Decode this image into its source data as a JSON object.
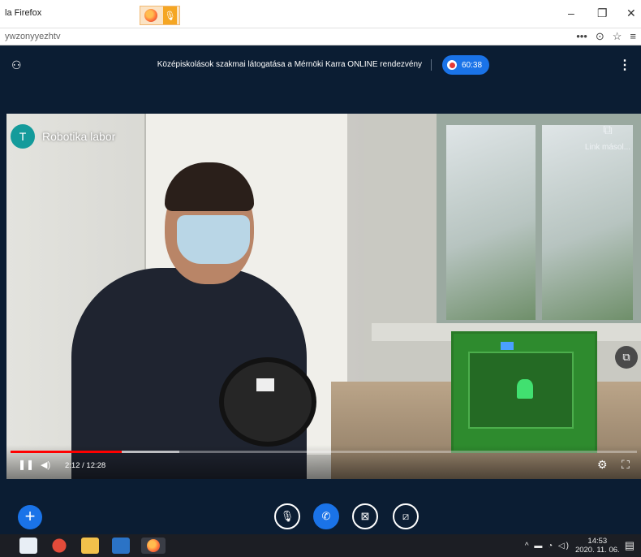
{
  "window": {
    "title": "la Firefox",
    "url": "ywzonyyezhtv",
    "minimize_glyph": "–",
    "maximize_glyph": "❐",
    "close_glyph": "✕",
    "menu_glyph": "•••",
    "pocket_glyph": "⊙",
    "star_glyph": "☆",
    "hamburger_glyph": "≡"
  },
  "meeting": {
    "title": "Középiskolások szakmai látogatása a Mérnöki Karra ONLINE rendezvény",
    "recording_time": "60:38",
    "more_glyph": "⋮",
    "people_glyph": "⚇"
  },
  "tile": {
    "avatar_letter": "T",
    "name": "Robotika labor",
    "link_copy_label": "Link másol...",
    "link_copy_glyph": "⧉"
  },
  "player": {
    "time": "2:12 / 12:28",
    "progress": 0.177,
    "buffered": 0.27,
    "pause_glyph": "❚❚",
    "volume_glyph": "◀)",
    "settings_glyph": "⚙",
    "fullscreen_glyph": "⛶",
    "pip_glyph": "⧉"
  },
  "call_controls": {
    "add_glyph": "+",
    "mic_glyph": "🎙",
    "call_glyph": "✆",
    "camera_glyph": "⊠",
    "share_glyph": "⧄"
  },
  "taskbar": {
    "time": "14:53",
    "date": "2020. 11. 06.",
    "tray_glyphs": "^ ▬ ◔ ◁)",
    "notification_glyph": "▤"
  }
}
